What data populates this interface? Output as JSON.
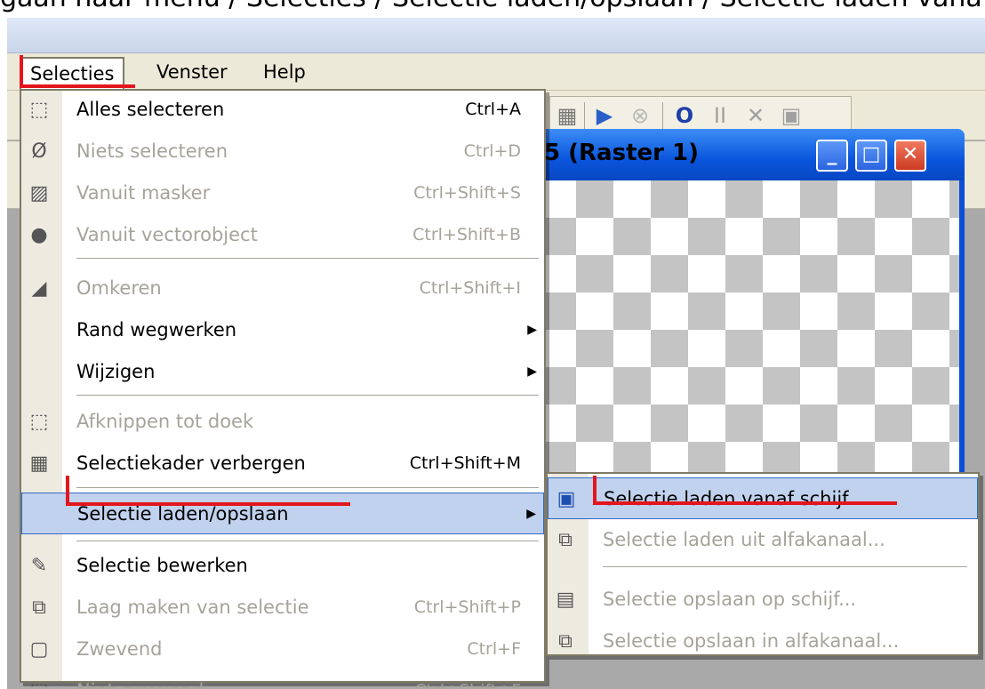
{
  "caption": "gaan naar menu / Selecties / Selectie laden/opslaan / Selectie laden vanaf schijf",
  "menubar": [
    {
      "label": "Selecties"
    },
    {
      "label": "Venster"
    },
    {
      "label": "Help"
    }
  ],
  "image_window": {
    "title": "5 (Raster 1)",
    "minimize": "_",
    "maximize": "□",
    "close": "✕"
  },
  "menu": {
    "items": [
      {
        "label": "Alles selecteren",
        "shortcut": "Ctrl+A",
        "icon": "select-all-icon",
        "glyph": "⬚",
        "enabled": true
      },
      {
        "label": "Niets selecteren",
        "shortcut": "Ctrl+D",
        "icon": "select-none-icon",
        "glyph": "Ø",
        "enabled": false
      },
      {
        "label": "Vanuit masker",
        "shortcut": "Ctrl+Shift+S",
        "icon": "from-mask-icon",
        "glyph": "▨",
        "enabled": false
      },
      {
        "label": "Vanuit vectorobject",
        "shortcut": "Ctrl+Shift+B",
        "icon": "from-vector-icon",
        "glyph": "●",
        "enabled": false
      },
      {
        "label": "Omkeren",
        "shortcut": "Ctrl+Shift+I",
        "icon": "invert-icon",
        "glyph": "◢",
        "enabled": false
      },
      {
        "label": "Rand wegwerken",
        "shortcut": "",
        "icon": "",
        "glyph": "",
        "enabled": true,
        "submenu": true
      },
      {
        "label": "Wijzigen",
        "shortcut": "",
        "icon": "",
        "glyph": "",
        "enabled": true,
        "submenu": true
      },
      {
        "label": "Afknippen tot doek",
        "shortcut": "",
        "icon": "crop-to-canvas-icon",
        "glyph": "⬚",
        "enabled": false
      },
      {
        "label": "Selectiekader verbergen",
        "shortcut": "Ctrl+Shift+M",
        "icon": "hide-marquee-icon",
        "glyph": "▦",
        "enabled": true
      },
      {
        "label": "Selectie laden/opslaan",
        "shortcut": "",
        "icon": "",
        "glyph": "",
        "enabled": true,
        "submenu": true,
        "highlighted": true
      },
      {
        "label": "Selectie bewerken",
        "shortcut": "",
        "icon": "edit-selection-icon",
        "glyph": "✎",
        "enabled": true
      },
      {
        "label": "Laag maken van selectie",
        "shortcut": "Ctrl+Shift+P",
        "icon": "promote-layer-icon",
        "glyph": "⧉",
        "enabled": false
      },
      {
        "label": "Zwevend",
        "shortcut": "Ctrl+F",
        "icon": "float-icon",
        "glyph": "▢",
        "enabled": false
      },
      {
        "label": "Niet-zwevend",
        "shortcut": "Ctrl+Shift+F",
        "icon": "defloat-icon",
        "glyph": "⬚",
        "enabled": false
      }
    ]
  },
  "submenu": {
    "items": [
      {
        "label": "Selectie laden vanaf schijf...",
        "icon": "load-from-disk-icon",
        "glyph": "▣",
        "enabled": true,
        "highlighted": true
      },
      {
        "label": "Selectie laden uit alfakanaal...",
        "icon": "load-from-alpha-icon",
        "glyph": "⧉",
        "enabled": false
      },
      {
        "label": "Selectie opslaan op schijf...",
        "icon": "save-to-disk-icon",
        "glyph": "▤",
        "enabled": false
      },
      {
        "label": "Selectie opslaan in alfakanaal...",
        "icon": "save-to-alpha-icon",
        "glyph": "⧉",
        "enabled": false
      }
    ]
  },
  "colors": {
    "highlight": "#c1d2ee",
    "highlight_border": "#316ac5",
    "annotation_red": "#e4161d",
    "disabled_text": "#a6a39a",
    "menubar_bg": "#ece9d8"
  }
}
